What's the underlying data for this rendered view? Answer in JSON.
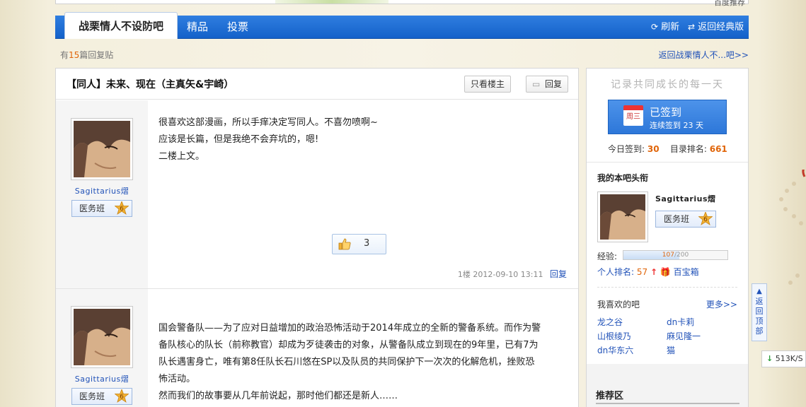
{
  "banner": {
    "corner_text": "百度推荐"
  },
  "nav": {
    "forum_tab": "战栗情人不设防吧",
    "tabs": [
      "精品",
      "投票"
    ],
    "refresh": "刷新",
    "back_classic": "返回经典版"
  },
  "sub": {
    "reply_prefix": "有",
    "reply_count": "15",
    "reply_suffix": "篇回复贴",
    "back_link": "返回战栗情人不...吧>>"
  },
  "thread": {
    "title": "【同人】未来、现在（主真矢&宇崎）",
    "only_host": "只看楼主",
    "reply_btn": "回复"
  },
  "posts": [
    {
      "username": "Sagittarius熠",
      "badge": "医务班",
      "level": "6",
      "lines": [
        "很喜欢这部漫画，所以手痒决定写同人。不喜勿喷啊~",
        "应该是长篇，但是我绝不会弃坑的，嗯!",
        "二楼上文。"
      ],
      "likes": "3",
      "floor_time": "1楼  2012-09-10 13:11",
      "reply": "回复"
    },
    {
      "username": "Sagittarius熠",
      "badge": "医务班",
      "level": "6",
      "lines": [
        "国会警备队——为了应对日益增加的政治恐怖活动于2014年成立的全新的警备系统。而作为警",
        "备队核心的队长（前称教官）却成为歹徒袭击的对象，从警备队成立到现在的9年里，已有7为",
        "队长遇害身亡，唯有第8任队长石川悠在SP以及队员的共同保护下一次次的化解危机，挫败恐",
        "怖活动。",
        "然而我们的故事要从几年前说起，那时他们都还是新人……"
      ]
    }
  ],
  "sidebar": {
    "slogan": "记录共同成长的每一天",
    "signin_title": "已签到",
    "signin_sub": "连续签到 23 天",
    "calendar_day": "周三",
    "today_label": "今日签到:",
    "today_value": "30",
    "rank_label": "目录排名:",
    "rank_value": "661",
    "head_title": "我的本吧头衔",
    "username": "Sagittarius熠",
    "badge": "医务班",
    "level": "6",
    "exp_label": "经验:",
    "exp_current": "107",
    "exp_total": "/200",
    "exp_fraction": 0.535,
    "personal_rank_label": "个人排名:",
    "personal_rank_value": "57",
    "treasure": "百宝箱",
    "fav_title": "我喜欢的吧",
    "more": "更多>>",
    "favs": [
      "龙之谷",
      "dn卡莉",
      "山根绫乃",
      "麻见隆一",
      "dn华东六",
      "猫"
    ],
    "recommend": "推荐区"
  },
  "widgets": {
    "back_top": "返回顶部",
    "net_speed": "513K/S"
  }
}
